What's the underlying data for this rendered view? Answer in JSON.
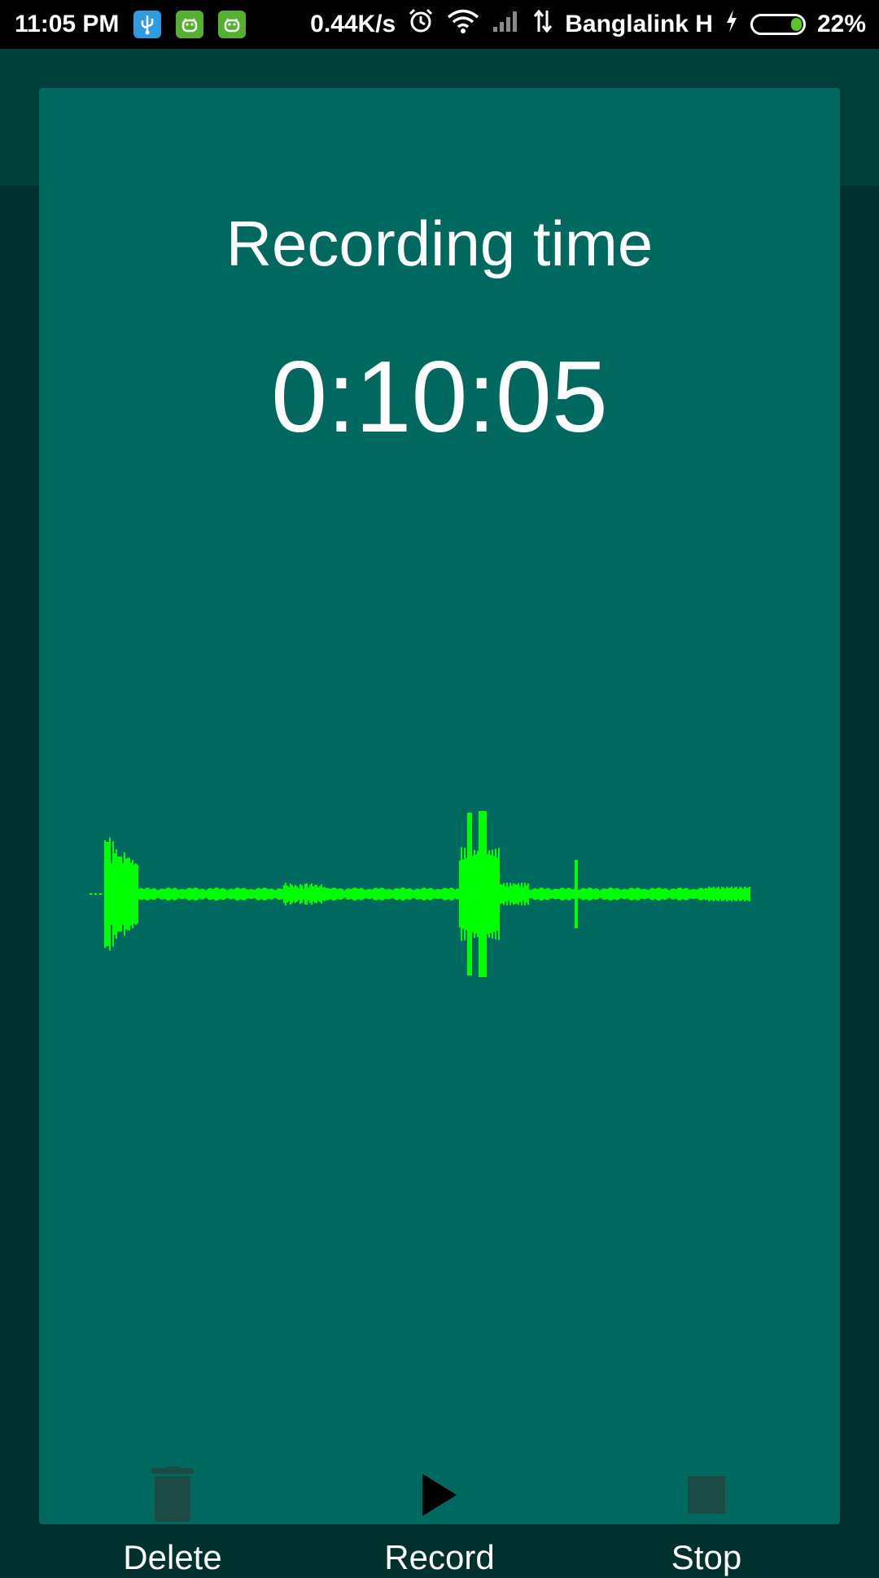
{
  "status_bar": {
    "time": "11:05 PM",
    "net_speed": "0.44K/s",
    "carrier": "Banglalink H",
    "battery_percent": "22%",
    "battery_level": 0.22,
    "notification_icons": [
      "usb-icon",
      "android-icon",
      "android-icon"
    ]
  },
  "dialog": {
    "title": "Recording time",
    "timer": "0:10:05",
    "waveform_color": "#00ff00",
    "actions": {
      "delete": {
        "label": "Delete",
        "icon": "trash-icon"
      },
      "record": {
        "label": "Record",
        "icon": "play-icon"
      },
      "stop": {
        "label": "Stop",
        "icon": "stop-icon"
      }
    }
  },
  "colors": {
    "dialog_bg": "#00695f",
    "page_bg": "#00312e",
    "waveform": "#00ff00"
  }
}
